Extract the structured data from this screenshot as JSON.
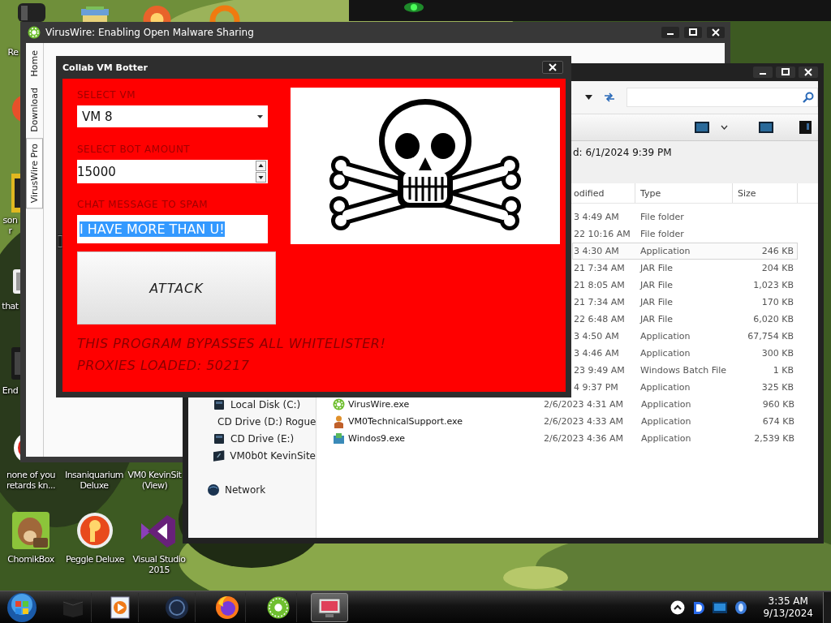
{
  "desktop_icons": [
    {
      "lines": [
        "Re"
      ]
    },
    {
      "lines": [
        "son",
        "r"
      ]
    },
    {
      "lines": [
        "that"
      ]
    },
    {
      "lines": [
        "End"
      ]
    },
    {
      "lines": [
        "none of you",
        "retards kn..."
      ]
    },
    {
      "lines": [
        "Insaniquarium",
        "Deluxe"
      ]
    },
    {
      "lines": [
        "VM0 KevinSit",
        "(View)"
      ]
    },
    {
      "lines": [
        "ChomikBox"
      ]
    },
    {
      "lines": [
        "Peggle Deluxe"
      ]
    },
    {
      "lines": [
        "Visual Studio",
        "2015"
      ]
    }
  ],
  "viruswire_window": {
    "title": "VirusWire: Enabling Open Malware Sharing",
    "tabs": [
      {
        "label": "Home",
        "selected": false
      },
      {
        "label": "Download",
        "selected": false
      },
      {
        "label": "VirusWire Pro",
        "selected": true
      }
    ]
  },
  "explorer": {
    "details": "d: 6/1/2024 9:39 PM",
    "columns": [
      "odified",
      "Type",
      "Size"
    ],
    "nav": [
      {
        "label": "Local Disk (C:)",
        "kind": "drive"
      },
      {
        "label": "CD Drive (D:) Rogue",
        "kind": "disc"
      },
      {
        "label": "CD Drive (E:)",
        "kind": "drive"
      },
      {
        "label": "VM0b0t KevinSite",
        "kind": "site"
      },
      {
        "label": "Network",
        "kind": "network"
      }
    ],
    "files": [
      {
        "date": "3 4:49 AM",
        "type": "File folder",
        "selected": false
      },
      {
        "date": "22 10:16 AM",
        "type": "File folder",
        "selected": false
      },
      {
        "date": "3 4:30 AM",
        "type": "Application",
        "size": "246 KB",
        "selected": true
      },
      {
        "date": "21 7:34 AM",
        "type": "JAR File",
        "size": "204 KB",
        "selected": false
      },
      {
        "date": "21 8:05 AM",
        "type": "JAR File",
        "size": "1,023 KB",
        "selected": false
      },
      {
        "date": "21 7:34 AM",
        "type": "JAR File",
        "size": "170 KB",
        "selected": false
      },
      {
        "date": "22 6:48 AM",
        "type": "JAR File",
        "size": "6,020 KB",
        "selected": false
      },
      {
        "date": "3 4:50 AM",
        "type": "Application",
        "size": "67,754 KB",
        "selected": false
      },
      {
        "date": "3 4:46 AM",
        "type": "Application",
        "size": "300 KB",
        "selected": false
      },
      {
        "date": "23 9:49 AM",
        "type": "Windows Batch File",
        "size": "1 KB",
        "selected": false
      },
      {
        "date": "4 9:37 PM",
        "type": "Application",
        "size": "325 KB",
        "selected": false
      },
      {
        "name": "VirusWire.exe",
        "date": "2/6/2023 4:31 AM",
        "type": "Application",
        "size": "960 KB",
        "selected": false
      },
      {
        "name": "VM0TechnicalSupport.exe",
        "date": "2/6/2023 4:33 AM",
        "type": "Application",
        "size": "674 KB",
        "selected": false
      },
      {
        "name": "Windos9.exe",
        "date": "2/6/2023 4:36 AM",
        "type": "Application",
        "size": "2,539 KB",
        "selected": false
      }
    ]
  },
  "botter": {
    "title": "Collab VM Botter",
    "vm_label": "SELECT VM",
    "vm_value": "VM 8",
    "amount_label": "SELECT BOT AMOUNT",
    "amount_value": "15000",
    "message_label": "CHAT MESSAGE TO SPAM",
    "message_value": "I HAVE MORE THAN U!",
    "message_selected": true,
    "attack_button": "ATTACK",
    "notes": [
      "THIS PROGRAM BYPASSES ALL WHITELISTER!",
      "PROXIES LOADED: 50217"
    ]
  },
  "taskbar": {
    "time": "3:35 AM",
    "date": "9/13/2024"
  }
}
